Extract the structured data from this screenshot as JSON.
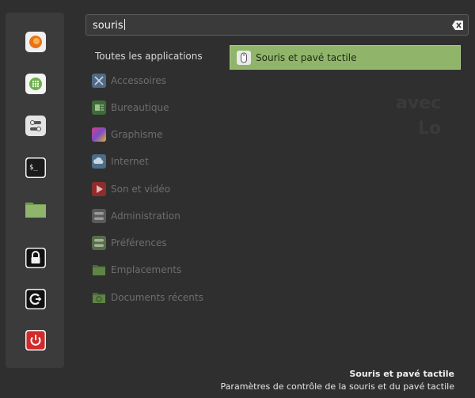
{
  "search": {
    "query": "souris",
    "clear_icon": "clear-text-icon"
  },
  "favorites": [
    {
      "name": "firefox",
      "icon": "firefox-icon",
      "color": "#e8721c"
    },
    {
      "name": "software-manager",
      "icon": "software-manager-icon",
      "color": "#f4f4f4"
    },
    {
      "name": "settings",
      "icon": "settings-icon",
      "color": "#e0e0e0"
    },
    {
      "name": "terminal",
      "icon": "terminal-icon",
      "color": "#1c1c1c"
    },
    {
      "name": "files",
      "icon": "folder-icon",
      "color": "#8fb56d"
    },
    {
      "name": "lock",
      "icon": "lock-icon",
      "color": "#111111"
    },
    {
      "name": "logout",
      "icon": "logout-icon",
      "color": "#111111"
    },
    {
      "name": "shutdown",
      "icon": "power-icon",
      "color": "#d22a2a"
    }
  ],
  "categories": {
    "all_label": "Toutes les applications",
    "items": [
      {
        "label": "Accessoires",
        "icon": "accessories-icon"
      },
      {
        "label": "Bureautique",
        "icon": "office-icon"
      },
      {
        "label": "Graphisme",
        "icon": "graphics-icon"
      },
      {
        "label": "Internet",
        "icon": "internet-icon"
      },
      {
        "label": "Son et vidéo",
        "icon": "multimedia-icon"
      },
      {
        "label": "Administration",
        "icon": "administration-icon"
      },
      {
        "label": "Préférences",
        "icon": "preferences-icon"
      },
      {
        "label": "Emplacements",
        "icon": "places-icon"
      },
      {
        "label": "Documents récents",
        "icon": "recent-documents-icon"
      }
    ]
  },
  "results": [
    {
      "label": "Souris et pavé tactile",
      "icon": "mouse-icon",
      "highlight_color": "#90b56a"
    }
  ],
  "footer": {
    "title": "Souris et pavé tactile",
    "description": "Paramètres de contrôle de la souris et du pavé tactile"
  }
}
